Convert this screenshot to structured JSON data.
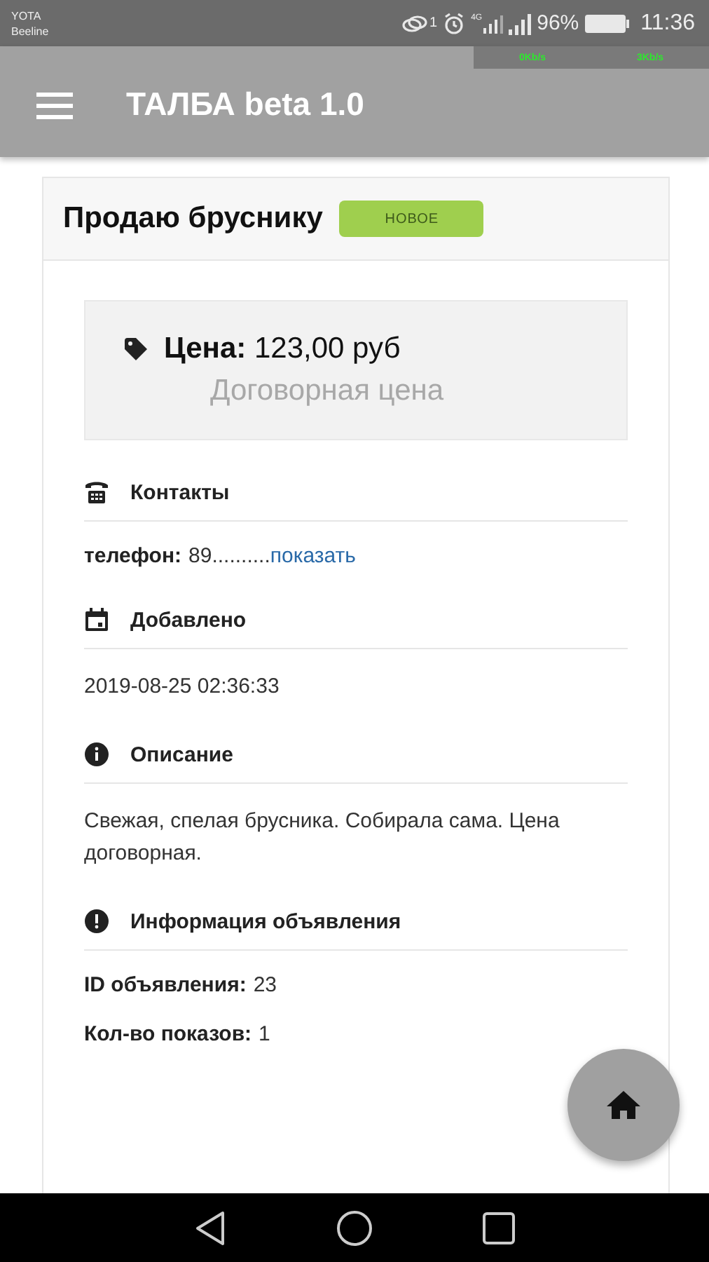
{
  "status_bar": {
    "carriers": [
      "YOTA",
      "Beeline"
    ],
    "sim_badge": "1",
    "network": "4G",
    "battery": "96%",
    "time": "11:36",
    "speeds": [
      "0Kb/s",
      "3Kb/s"
    ]
  },
  "app_bar": {
    "title": "ТАЛБА beta 1.0"
  },
  "listing": {
    "title": "Продаю бруснику",
    "badge": "НОВОЕ",
    "price": {
      "label": "Цена:",
      "value": "123,00 руб",
      "note": "Договорная цена"
    },
    "sections": [
      {
        "title": "Контакты",
        "kind": "fields",
        "fields": [
          {
            "label": "телефон:",
            "value": "89..........",
            "link": "показать"
          }
        ]
      },
      {
        "title": "Добавлено",
        "kind": "text",
        "text": "2019-08-25 02:36:33"
      },
      {
        "title": "Описание",
        "kind": "text",
        "text": "Свежая, спелая брусника. Собирала сама. Цена договорная."
      },
      {
        "title": "Информация объявления",
        "kind": "fields",
        "fields": [
          {
            "label": "ID объявления:",
            "value": "23"
          },
          {
            "label": "Кол-во показов:",
            "value": "1"
          }
        ]
      }
    ]
  }
}
